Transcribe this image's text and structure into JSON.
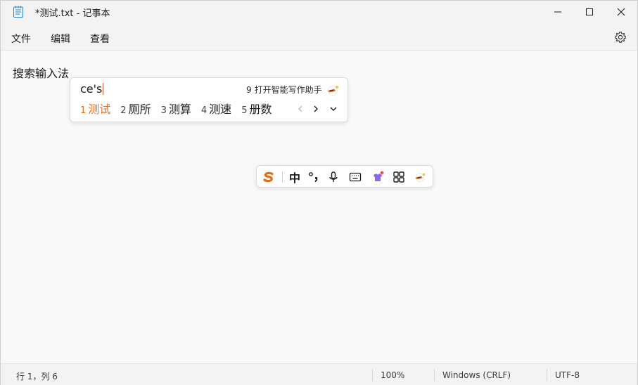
{
  "window": {
    "title": "*测试.txt - 记事本",
    "controls": [
      "minimize-icon",
      "maximize-icon",
      "close-icon"
    ]
  },
  "menu": {
    "items": [
      "文件",
      "编辑",
      "查看"
    ],
    "settings_icon": "gear-icon"
  },
  "editor": {
    "text": "搜索输入法"
  },
  "ime": {
    "composition": "ce's",
    "assist_number": "9",
    "assist_label": "打开智能写作助手",
    "candidates": [
      {
        "num": "1",
        "text": "测试"
      },
      {
        "num": "2",
        "text": "厕所"
      },
      {
        "num": "3",
        "text": "测算"
      },
      {
        "num": "4",
        "text": "测速"
      },
      {
        "num": "5",
        "text": "册数"
      }
    ],
    "accent_color": "#e0701f",
    "toolbar": {
      "mode_label": "中",
      "items": [
        "sogou-logo-icon",
        "chinese-mode",
        "punctuation-icon",
        "microphone-icon",
        "keyboard-icon",
        "skin-icon",
        "toolbox-icon",
        "assistant-icon"
      ]
    }
  },
  "status": {
    "position": "行 1，列 6",
    "zoom": "100%",
    "line_ending": "Windows (CRLF)",
    "encoding": "UTF-8"
  }
}
